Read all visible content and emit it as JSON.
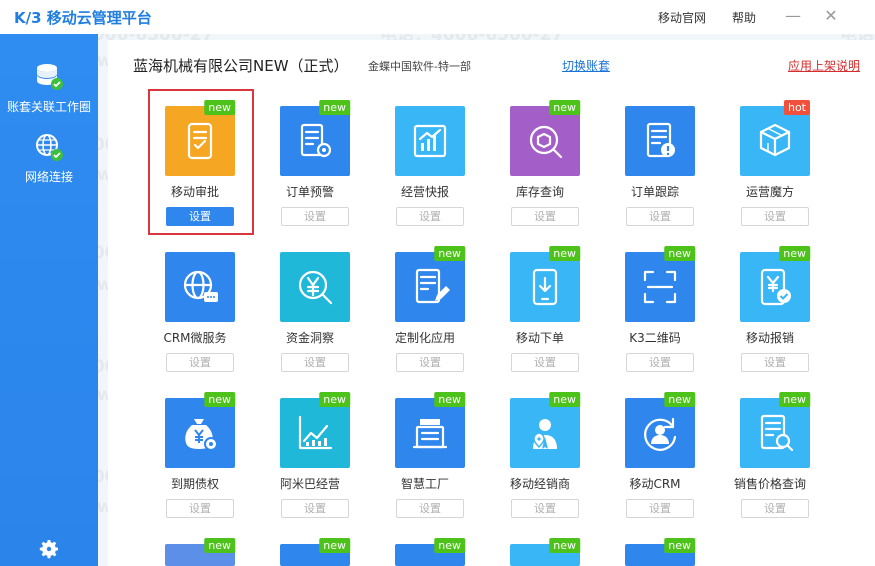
{
  "titlebar": {
    "app_title": "K/3  移动云管理平台",
    "official_site": "移动官网",
    "help": "帮助",
    "minimize": "—",
    "close": "✕"
  },
  "sidebar": {
    "items": [
      {
        "label": "账套关联工作圈",
        "icon": "database-check-icon"
      },
      {
        "label": "网络连接",
        "icon": "globe-check-icon"
      }
    ],
    "settings_icon": "gear-icon"
  },
  "header": {
    "company": "蓝海机械有限公司NEW（正式）",
    "account": "金蝶中国软件-特一部",
    "switch_account": "切换账套",
    "help_link": "应用上架说明"
  },
  "setting_label": "设置",
  "apps": [
    {
      "name": "移动审批",
      "color": "#f5a623",
      "badge": "new",
      "selected": true,
      "icon": "tablet-check-icon"
    },
    {
      "name": "订单预警",
      "color": "#2f86ec",
      "badge": "new",
      "icon": "document-search-icon"
    },
    {
      "name": "经营快报",
      "color": "#39b6f5",
      "badge": "",
      "icon": "bar-chart-icon"
    },
    {
      "name": "库存查询",
      "color": "#a45ec8",
      "badge": "new",
      "icon": "box-search-icon"
    },
    {
      "name": "订单跟踪",
      "color": "#2f86ec",
      "badge": "",
      "icon": "document-alert-icon"
    },
    {
      "name": "运营魔方",
      "color": "#39b6f5",
      "badge": "hot",
      "icon": "cube-icon"
    },
    {
      "name": "CRM微服务",
      "color": "#2f86ec",
      "badge": "",
      "icon": "globe-chat-icon"
    },
    {
      "name": "资金洞察",
      "color": "#1fb8d8",
      "badge": "",
      "icon": "yuan-search-icon"
    },
    {
      "name": "定制化应用",
      "color": "#2f86ec",
      "badge": "new",
      "icon": "document-edit-icon"
    },
    {
      "name": "移动下单",
      "color": "#39b6f5",
      "badge": "new",
      "icon": "tablet-download-icon"
    },
    {
      "name": "K3二维码",
      "color": "#2f86ec",
      "badge": "new",
      "icon": "qr-scan-icon"
    },
    {
      "name": "移动报销",
      "color": "#39b6f5",
      "badge": "new",
      "icon": "phone-yuan-check-icon"
    },
    {
      "name": "到期债权",
      "color": "#2f86ec",
      "badge": "new",
      "icon": "money-bag-icon"
    },
    {
      "name": "阿米巴经营",
      "color": "#1fb8d8",
      "badge": "new",
      "icon": "line-chart-icon"
    },
    {
      "name": "智慧工厂",
      "color": "#2f86ec",
      "badge": "new",
      "icon": "factory-icon"
    },
    {
      "name": "移动经销商",
      "color": "#39b6f5",
      "badge": "new",
      "icon": "person-location-icon"
    },
    {
      "name": "移动CRM",
      "color": "#2f86ec",
      "badge": "new",
      "icon": "person-refresh-icon"
    },
    {
      "name": "销售价格查询",
      "color": "#39b6f5",
      "badge": "new",
      "icon": "document-price-search-icon"
    }
  ],
  "partial_apps": [
    {
      "color": "#5b8fe8",
      "badge": "new"
    },
    {
      "color": "#2f86ec",
      "badge": "new"
    },
    {
      "color": "#2f86ec",
      "badge": "new"
    },
    {
      "color": "#39b6f5",
      "badge": "new"
    },
    {
      "color": "#2f86ec",
      "badge": "new"
    }
  ],
  "watermark": {
    "phone": "电话：4006-6500-27",
    "site": "网址：www.tdxsoft.com"
  }
}
